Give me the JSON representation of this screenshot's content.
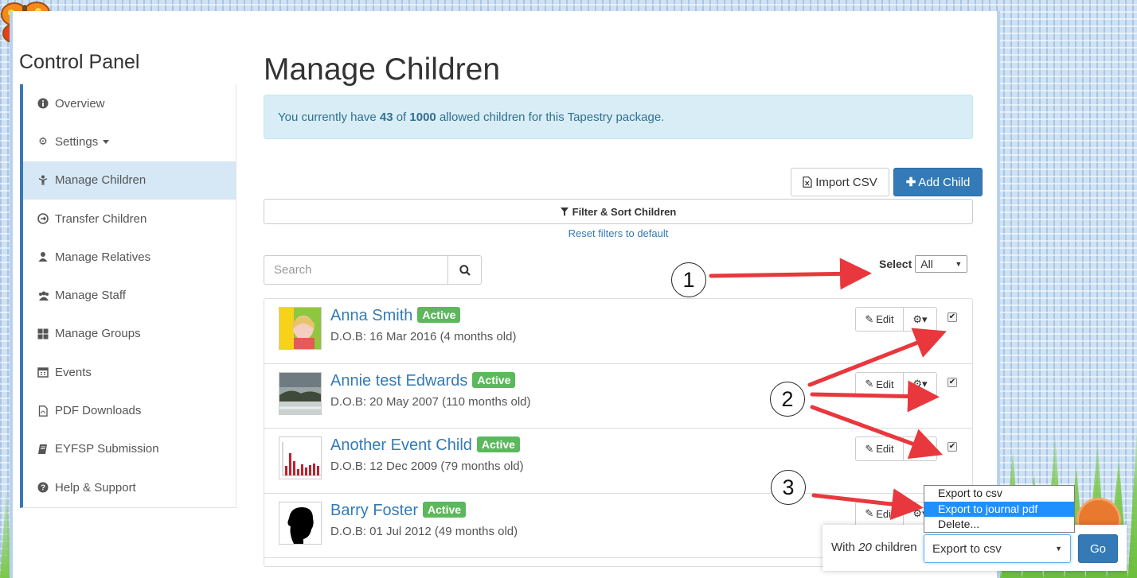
{
  "sidebar": {
    "title": "Control Panel",
    "items": [
      {
        "label": "Overview",
        "icon": "info-circle-icon"
      },
      {
        "label": "Settings",
        "icon": "cog-icon"
      },
      {
        "label": "Manage Children",
        "icon": "child-icon"
      },
      {
        "label": "Transfer Children",
        "icon": "transfer-icon"
      },
      {
        "label": "Manage Relatives",
        "icon": "user-icon"
      },
      {
        "label": "Manage Staff",
        "icon": "users-icon"
      },
      {
        "label": "Manage Groups",
        "icon": "grid-icon"
      },
      {
        "label": "Events",
        "icon": "calendar-icon"
      },
      {
        "label": "PDF Downloads",
        "icon": "pdf-file-icon"
      },
      {
        "label": "EYFSP Submission",
        "icon": "book-icon"
      },
      {
        "label": "Help & Support",
        "icon": "question-circle-icon"
      }
    ]
  },
  "main": {
    "title": "Manage Children",
    "alert": {
      "prefix": "You currently have ",
      "count": "43",
      "middle": " of ",
      "max": "1000",
      "suffix": " allowed children for this Tapestry package."
    },
    "import_label": "Import CSV",
    "add_label": "Add Child",
    "filter_label": "Filter & Sort Children",
    "reset_label": "Reset filters to default",
    "search_placeholder": "Search",
    "select_label": "Select",
    "select_value": "All",
    "children": [
      {
        "name": "Anna Smith",
        "status": "Active",
        "dob": "D.O.B: 16 Mar 2016 (4 months old)",
        "edit": "Edit"
      },
      {
        "name": "Annie test Edwards",
        "status": "Active",
        "dob": "D.O.B: 20 May 2007 (110 months old)",
        "edit": "Edit"
      },
      {
        "name": "Another Event Child",
        "status": "Active",
        "dob": "D.O.B: 12 Dec 2009 (79 months old)",
        "edit": "Edit"
      },
      {
        "name": "Barry Foster",
        "status": "Active",
        "dob": "D.O.B: 01 Jul 2012 (49 months old)",
        "edit": "Edit"
      }
    ]
  },
  "bulk": {
    "label_prefix": "With ",
    "count": "20",
    "label_suffix": " children",
    "selected": "Export to csv",
    "go_label": "Go",
    "options": [
      "Export to csv",
      "Export to journal pdf",
      "Delete..."
    ],
    "highlighted_index": 1
  },
  "callouts": [
    "1",
    "2",
    "3"
  ],
  "colors": {
    "primary": "#337ab7",
    "active_badge": "#5cb85c",
    "alert_bg": "#d9edf7",
    "arrow": "#e8383d"
  }
}
